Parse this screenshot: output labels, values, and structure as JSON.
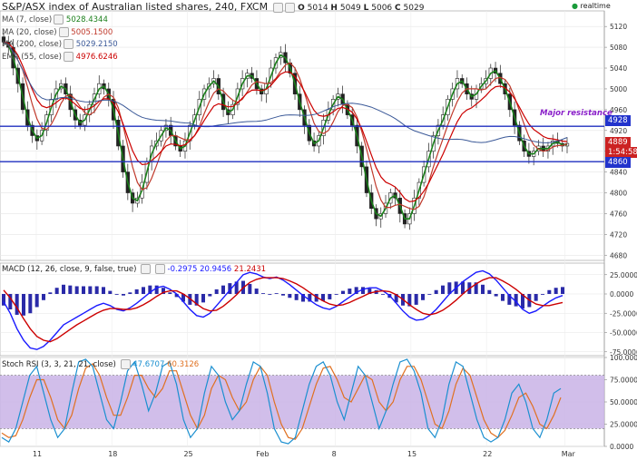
{
  "header": {
    "title": "S&P/ASX index of Australian listed shares, 240, FXCM",
    "ohlc": {
      "o_label": "O",
      "o": "5014",
      "h_label": "H",
      "h": "5049",
      "l_label": "L",
      "l": "5006",
      "c_label": "C",
      "c": "5029"
    },
    "realtime": "realtime"
  },
  "legend": [
    {
      "label": "MA (7, close)",
      "value": "5028.4344",
      "color": "#1a7f1a"
    },
    {
      "label": "MA (20, close)",
      "value": "5005.1500",
      "color": "#c0392b"
    },
    {
      "label": "MA (200, close)",
      "value": "5029.2150",
      "color": "#3b5998"
    },
    {
      "label": "EMA (55, close)",
      "value": "4976.6246",
      "color": "#cc0000"
    }
  ],
  "annotation": "Major resistance",
  "price_tags": [
    {
      "text": "4928",
      "color": "#2233cc"
    },
    {
      "text": "4889",
      "color": "#cc2222"
    },
    {
      "text": "1:54:58",
      "color": "#cc2222"
    },
    {
      "text": "4860",
      "color": "#2233cc"
    }
  ],
  "macd": {
    "label": "MACD (12, 26, close, 9, false, true)",
    "values": [
      "-0.2975",
      "20.9456",
      "21.2431"
    ],
    "colors": [
      "#1a1aff",
      "#1a1aff",
      "#cc0000"
    ]
  },
  "stoch": {
    "label": "Stoch RSI (3, 3, 21, 21, close)",
    "values": [
      "47.6707",
      "60.3126"
    ],
    "colors": [
      "#1a8fd0",
      "#e07020"
    ]
  },
  "colors": {
    "up": "#1a7f1a",
    "down": "#cc0000",
    "hline": "#1f2fbf",
    "stoch_band": "#c9b3e6"
  },
  "chart_data": [
    {
      "type": "candlestick",
      "title": "S&P/ASX index of Australian listed shares, 240, FXCM",
      "ylim": [
        4670,
        5150
      ],
      "y_ticks": [
        "5120",
        "5080",
        "5040",
        "5000",
        "4960",
        "4920",
        "4880",
        "4840",
        "4800",
        "4760",
        "4720",
        "4680"
      ],
      "x_ticks": [
        "11",
        "18",
        "25",
        "Feb",
        "8",
        "15",
        "22",
        "Mar"
      ],
      "horizontal_lines": [
        {
          "name": "Major resistance",
          "value": 4928
        },
        {
          "value": 4860
        }
      ],
      "close": [
        5090,
        5080,
        5040,
        5010,
        4960,
        4930,
        4910,
        4900,
        4920,
        4950,
        4980,
        5000,
        5010,
        4990,
        4960,
        4940,
        4930,
        4950,
        4970,
        4990,
        5010,
        5000,
        4980,
        4940,
        4890,
        4840,
        4800,
        4780,
        4790,
        4820,
        4860,
        4890,
        4900,
        4920,
        4930,
        4910,
        4890,
        4880,
        4900,
        4930,
        4950,
        4980,
        5000,
        5010,
        5020,
        4990,
        4960,
        4950,
        4970,
        5000,
        5020,
        5030,
        5020,
        5000,
        4990,
        5010,
        5040,
        5060,
        5070,
        5050,
        5030,
        4990,
        4960,
        4930,
        4900,
        4890,
        4910,
        4940,
        4960,
        4980,
        4990,
        4970,
        4950,
        4930,
        4890,
        4850,
        4800,
        4770,
        4750,
        4760,
        4780,
        4800,
        4790,
        4760,
        4740,
        4760,
        4790,
        4820,
        4850,
        4880,
        4910,
        4930,
        4950,
        4980,
        5000,
        5020,
        5010,
        4990,
        4980,
        5000,
        5010,
        5020,
        5040,
        5030,
        5010,
        4990,
        4960,
        4930,
        4900,
        4880,
        4870,
        4880,
        4890,
        4880,
        4890,
        4900,
        4895,
        4890,
        4895
      ]
    },
    {
      "type": "line",
      "title": "MACD (12, 26, close, 9, false, true)",
      "ylim": [
        -80,
        40
      ],
      "y_ticks": [
        "25.0000",
        "0.0000",
        "-25.0000",
        "-50.0000",
        "-75.0000"
      ],
      "series": [
        {
          "name": "MACD",
          "values": [
            -10,
            -25,
            -45,
            -60,
            -70,
            -72,
            -68,
            -60,
            -50,
            -40,
            -35,
            -30,
            -25,
            -20,
            -15,
            -12,
            -15,
            -20,
            -22,
            -18,
            -12,
            -5,
            2,
            8,
            10,
            6,
            0,
            -10,
            -20,
            -28,
            -30,
            -25,
            -15,
            -5,
            5,
            15,
            25,
            28,
            26,
            22,
            20,
            22,
            18,
            12,
            5,
            -2,
            -8,
            -14,
            -18,
            -20,
            -16,
            -10,
            -4,
            2,
            6,
            8,
            8,
            4,
            -2,
            -12,
            -22,
            -30,
            -34,
            -33,
            -28,
            -20,
            -10,
            0,
            8,
            16,
            22,
            28,
            30,
            26,
            18,
            8,
            -2,
            -10,
            -20,
            -25,
            -22,
            -16,
            -10,
            -5,
            -2
          ]
        },
        {
          "name": "Signal",
          "values": [
            5,
            -5,
            -18,
            -32,
            -45,
            -55,
            -60,
            -62,
            -58,
            -52,
            -46,
            -40,
            -35,
            -30,
            -25,
            -21,
            -19,
            -19,
            -20,
            -20,
            -18,
            -14,
            -9,
            -3,
            2,
            4,
            4,
            0,
            -6,
            -13,
            -19,
            -22,
            -21,
            -16,
            -9,
            -1,
            8,
            15,
            19,
            21,
            21,
            21,
            20,
            17,
            13,
            8,
            2,
            -4,
            -9,
            -13,
            -15,
            -14,
            -11,
            -7,
            -3,
            1,
            3,
            4,
            3,
            -1,
            -7,
            -14,
            -20,
            -25,
            -27,
            -25,
            -21,
            -15,
            -8,
            0,
            7,
            13,
            18,
            21,
            21,
            17,
            12,
            6,
            -1,
            -8,
            -13,
            -15,
            -15,
            -13,
            -11
          ]
        }
      ]
    },
    {
      "type": "line",
      "title": "Stoch RSI (3, 3, 21, 21, close)",
      "ylim": [
        0,
        100
      ],
      "y_ticks": [
        "100.0000",
        "75.0000",
        "50.0000",
        "25.0000",
        "0.0000"
      ],
      "series": [
        {
          "name": "%K",
          "values": [
            10,
            5,
            20,
            50,
            80,
            90,
            60,
            30,
            10,
            20,
            60,
            95,
            98,
            90,
            60,
            30,
            20,
            50,
            85,
            95,
            70,
            40,
            60,
            90,
            95,
            70,
            30,
            10,
            20,
            60,
            90,
            80,
            50,
            30,
            40,
            70,
            95,
            90,
            60,
            20,
            5,
            3,
            10,
            40,
            70,
            90,
            95,
            80,
            50,
            30,
            60,
            90,
            80,
            50,
            20,
            40,
            70,
            95,
            98,
            85,
            60,
            20,
            10,
            30,
            70,
            95,
            90,
            60,
            30,
            10,
            5,
            10,
            30,
            60,
            70,
            50,
            20,
            10,
            30,
            60,
            65
          ]
        },
        {
          "name": "%D",
          "values": [
            15,
            10,
            12,
            30,
            55,
            75,
            75,
            55,
            30,
            20,
            35,
            65,
            88,
            93,
            80,
            55,
            35,
            35,
            55,
            80,
            80,
            65,
            55,
            65,
            85,
            85,
            60,
            35,
            20,
            35,
            65,
            80,
            75,
            55,
            40,
            50,
            75,
            90,
            80,
            50,
            25,
            10,
            8,
            20,
            45,
            70,
            88,
            90,
            75,
            55,
            50,
            65,
            80,
            75,
            50,
            40,
            50,
            75,
            90,
            90,
            75,
            50,
            25,
            20,
            40,
            70,
            88,
            80,
            55,
            30,
            15,
            10,
            18,
            35,
            55,
            60,
            45,
            25,
            20,
            35,
            55
          ]
        }
      ]
    }
  ]
}
